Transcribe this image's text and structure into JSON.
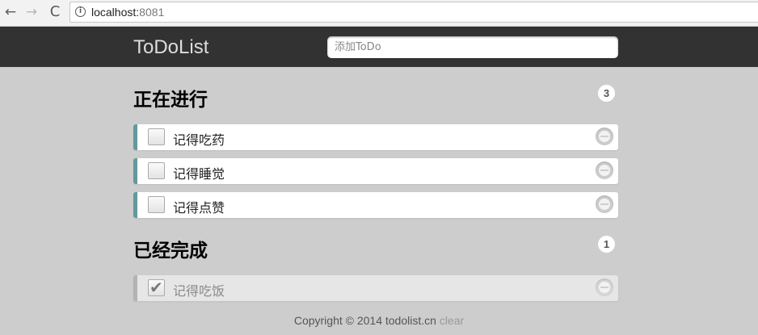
{
  "browser": {
    "url_host": "localhost:",
    "url_port": "8081",
    "nav_back": "←",
    "nav_forward": "→",
    "nav_reload": "C",
    "info_icon": "i"
  },
  "header": {
    "logo": "ToDoList",
    "input_placeholder": "添加ToDo"
  },
  "sections": {
    "in_progress": {
      "title": "正在进行",
      "count": "3",
      "items": [
        {
          "text": "记得吃药",
          "checked": false
        },
        {
          "text": "记得睡觉",
          "checked": false
        },
        {
          "text": "记得点赞",
          "checked": false
        }
      ]
    },
    "completed": {
      "title": "已经完成",
      "count": "1",
      "items": [
        {
          "text": "记得吃饭",
          "checked": true,
          "check_glyph": "✔"
        }
      ]
    }
  },
  "footer": {
    "copyright": "Copyright © 2014 todolist.cn",
    "clear": "clear"
  },
  "colors": {
    "page_bg": "#cdcdcd",
    "header_bg": "#323232",
    "active_accent": "#629a9c",
    "done_accent": "#b3b3b3"
  }
}
